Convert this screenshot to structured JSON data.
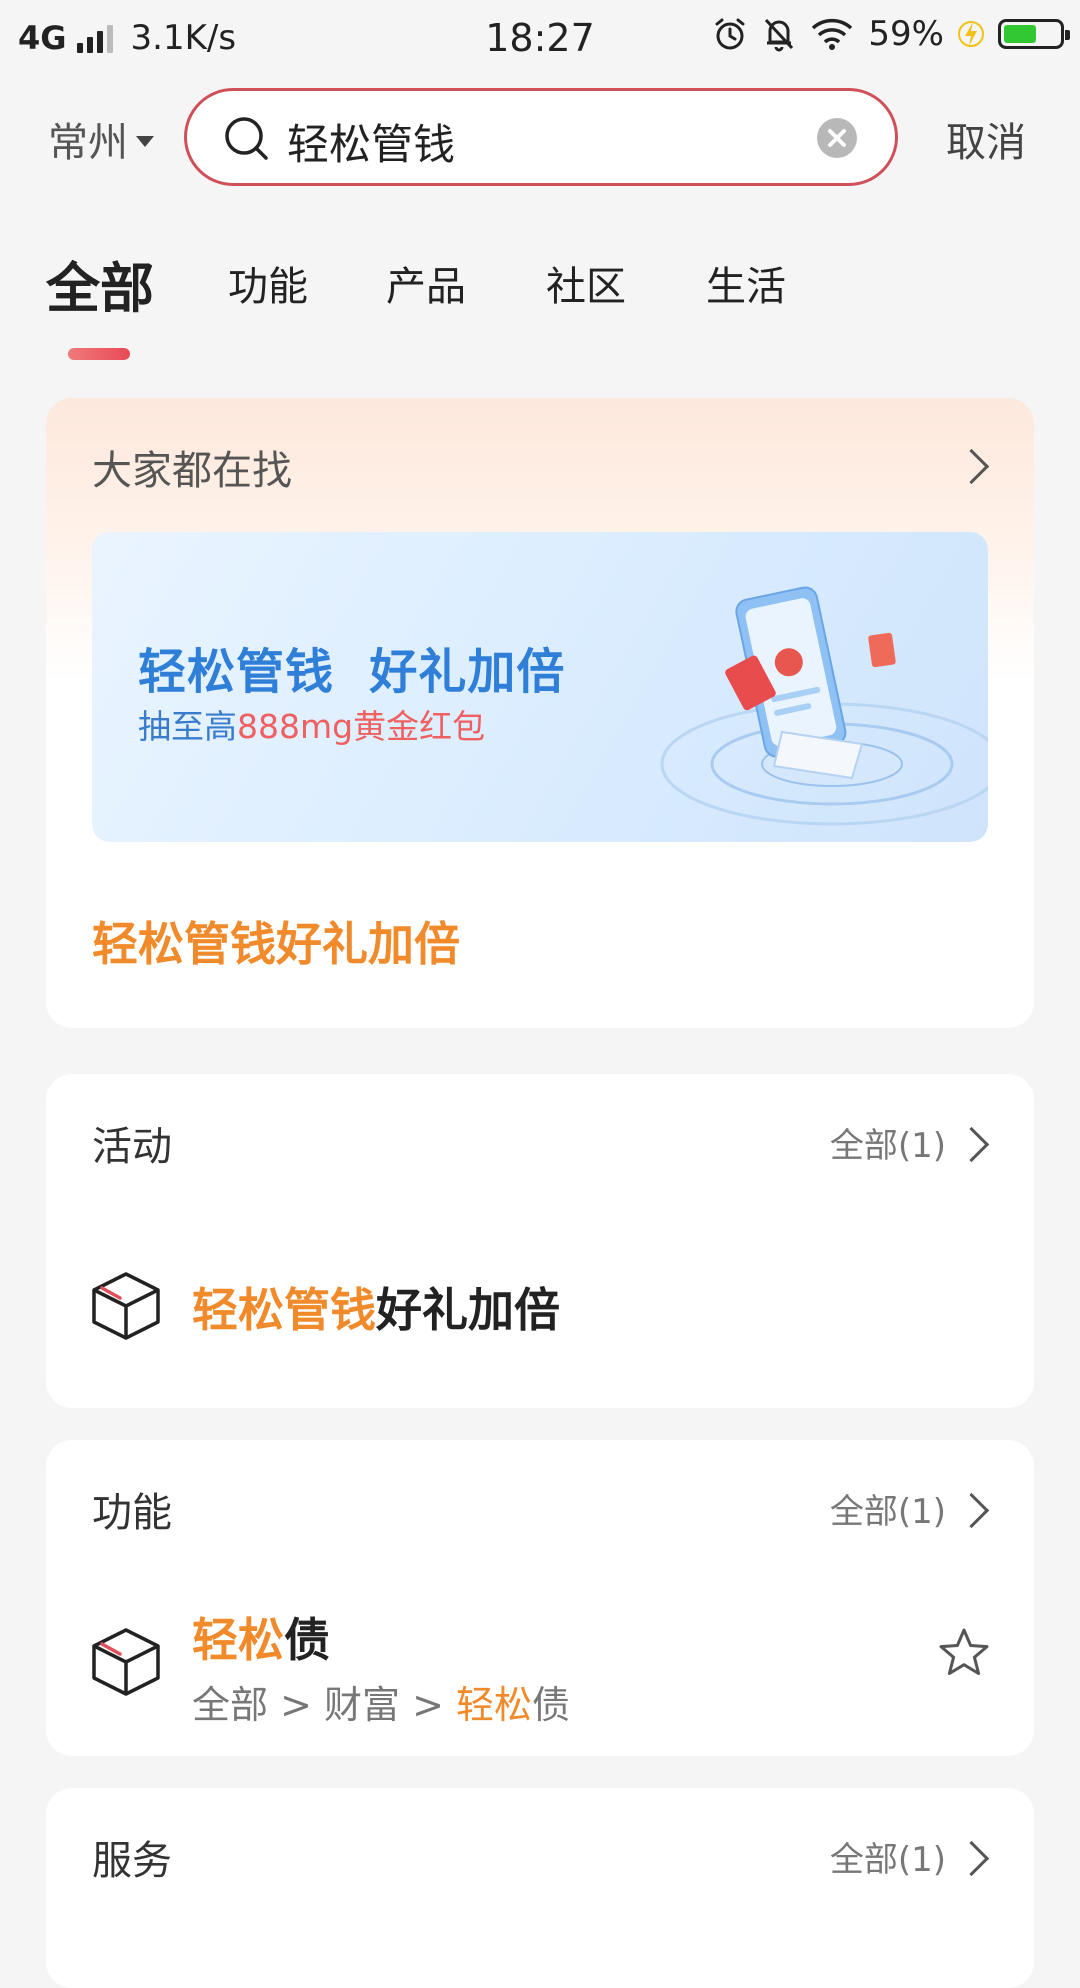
{
  "status_bar": {
    "network": "4G",
    "speed": "3.1K/s",
    "time": "18:27",
    "battery": "59%",
    "battery_level": 0.59,
    "battery_color": "#32c832"
  },
  "header": {
    "city": "常州",
    "search_value": "轻松管钱",
    "cancel_label": "取消"
  },
  "tabs": [
    {
      "label": "全部",
      "active": true
    },
    {
      "label": "功能",
      "active": false
    },
    {
      "label": "产品",
      "active": false
    },
    {
      "label": "社区",
      "active": false
    },
    {
      "label": "生活",
      "active": false
    }
  ],
  "hot": {
    "title": "大家都在找",
    "banner_title": "轻松管钱  好礼加倍",
    "banner_sub_prefix": "抽至高",
    "banner_sub_highlight": "888mg黄金红包",
    "link": "轻松管钱好礼加倍"
  },
  "activity": {
    "title": "活动",
    "all_label": "全部(1)",
    "item_highlight": "轻松管钱",
    "item_rest": "好礼加倍"
  },
  "functions": {
    "title": "功能",
    "all_label": "全部(1)",
    "item_highlight": "轻松",
    "item_rest": "债",
    "path_prefix": "全部 > 财富 > ",
    "path_highlight": "轻松",
    "path_rest": "债"
  },
  "service": {
    "title": "服务",
    "all_label": "全部(1)"
  },
  "colors": {
    "accent_orange": "#f08a2a",
    "search_border": "#d0505a",
    "banner_blue": "#2f7fd8",
    "banner_red": "#f06060"
  },
  "icons": [
    "signal-icon",
    "alarm-icon",
    "mute-bell-icon",
    "wifi-icon",
    "charging-icon",
    "battery-icon",
    "search-icon",
    "clear-icon",
    "caret-down-icon",
    "chevron-right-icon",
    "box-icon",
    "star-icon"
  ]
}
